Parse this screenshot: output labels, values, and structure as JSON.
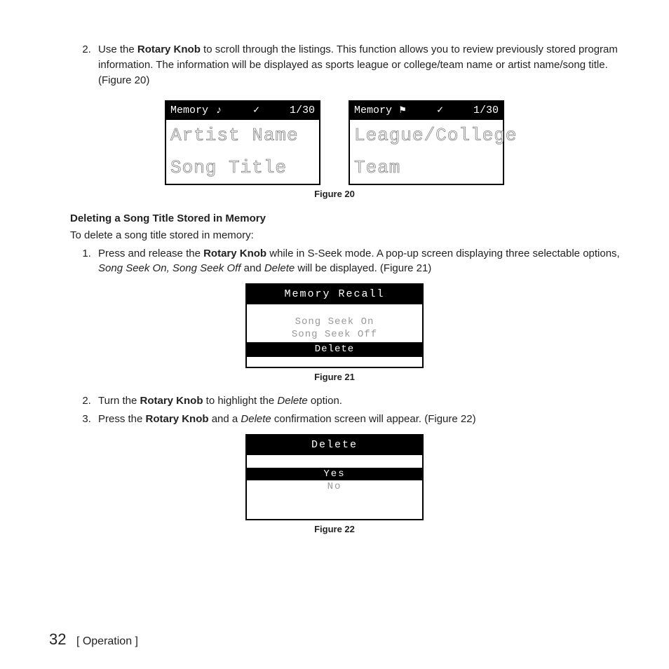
{
  "step2_top": {
    "num": "2.",
    "pre": "Use the ",
    "knob": "Rotary Knob",
    "post": " to scroll through the listings. This function allows you to review previously stored program information. The information will be displayed as sports league or college/team name or artist name/song title. (Figure 20)"
  },
  "fig20": {
    "caption": "Figure 20",
    "left": {
      "head_label": "Memory",
      "head_icon": "♪",
      "head_check": "✓",
      "head_count": "1/30",
      "line1": "Artist Name",
      "line2": "Song Title"
    },
    "right": {
      "head_label": "Memory",
      "head_icon": "⚑",
      "head_check": "✓",
      "head_count": "1/30",
      "line1": "League/College",
      "line2": "Team"
    }
  },
  "subheading": "Deleting a Song Title Stored in Memory",
  "intro": "To delete a song title stored in memory:",
  "del_step1": {
    "num": "1.",
    "pre": "Press and release the ",
    "knob": "Rotary Knob",
    "mid": " while in S-Seek mode.  A pop-up screen displaying three selectable options, ",
    "opts": "Song Seek On, Song Seek Off",
    "and": " and ",
    "del": "Delete",
    "post": " will be displayed. (Figure 21)"
  },
  "fig21": {
    "caption": "Figure 21",
    "title": "Memory Recall",
    "opt1": "Song Seek On",
    "opt2": "Song Seek Off",
    "opt3": "Delete"
  },
  "del_step2": {
    "num": "2.",
    "pre": "Turn the ",
    "knob": "Rotary Knob",
    "mid": " to highlight the ",
    "del": "Delete",
    "post": " option."
  },
  "del_step3": {
    "num": "3.",
    "pre": "Press the ",
    "knob": "Rotary Knob",
    "mid": " and a ",
    "del": "Delete",
    "post": " confirmation screen will appear. (Figure 22)"
  },
  "fig22": {
    "caption": "Figure 22",
    "title": "Delete",
    "yes": "Yes",
    "no": "No"
  },
  "footer": {
    "page": "32",
    "section": "Operation"
  }
}
